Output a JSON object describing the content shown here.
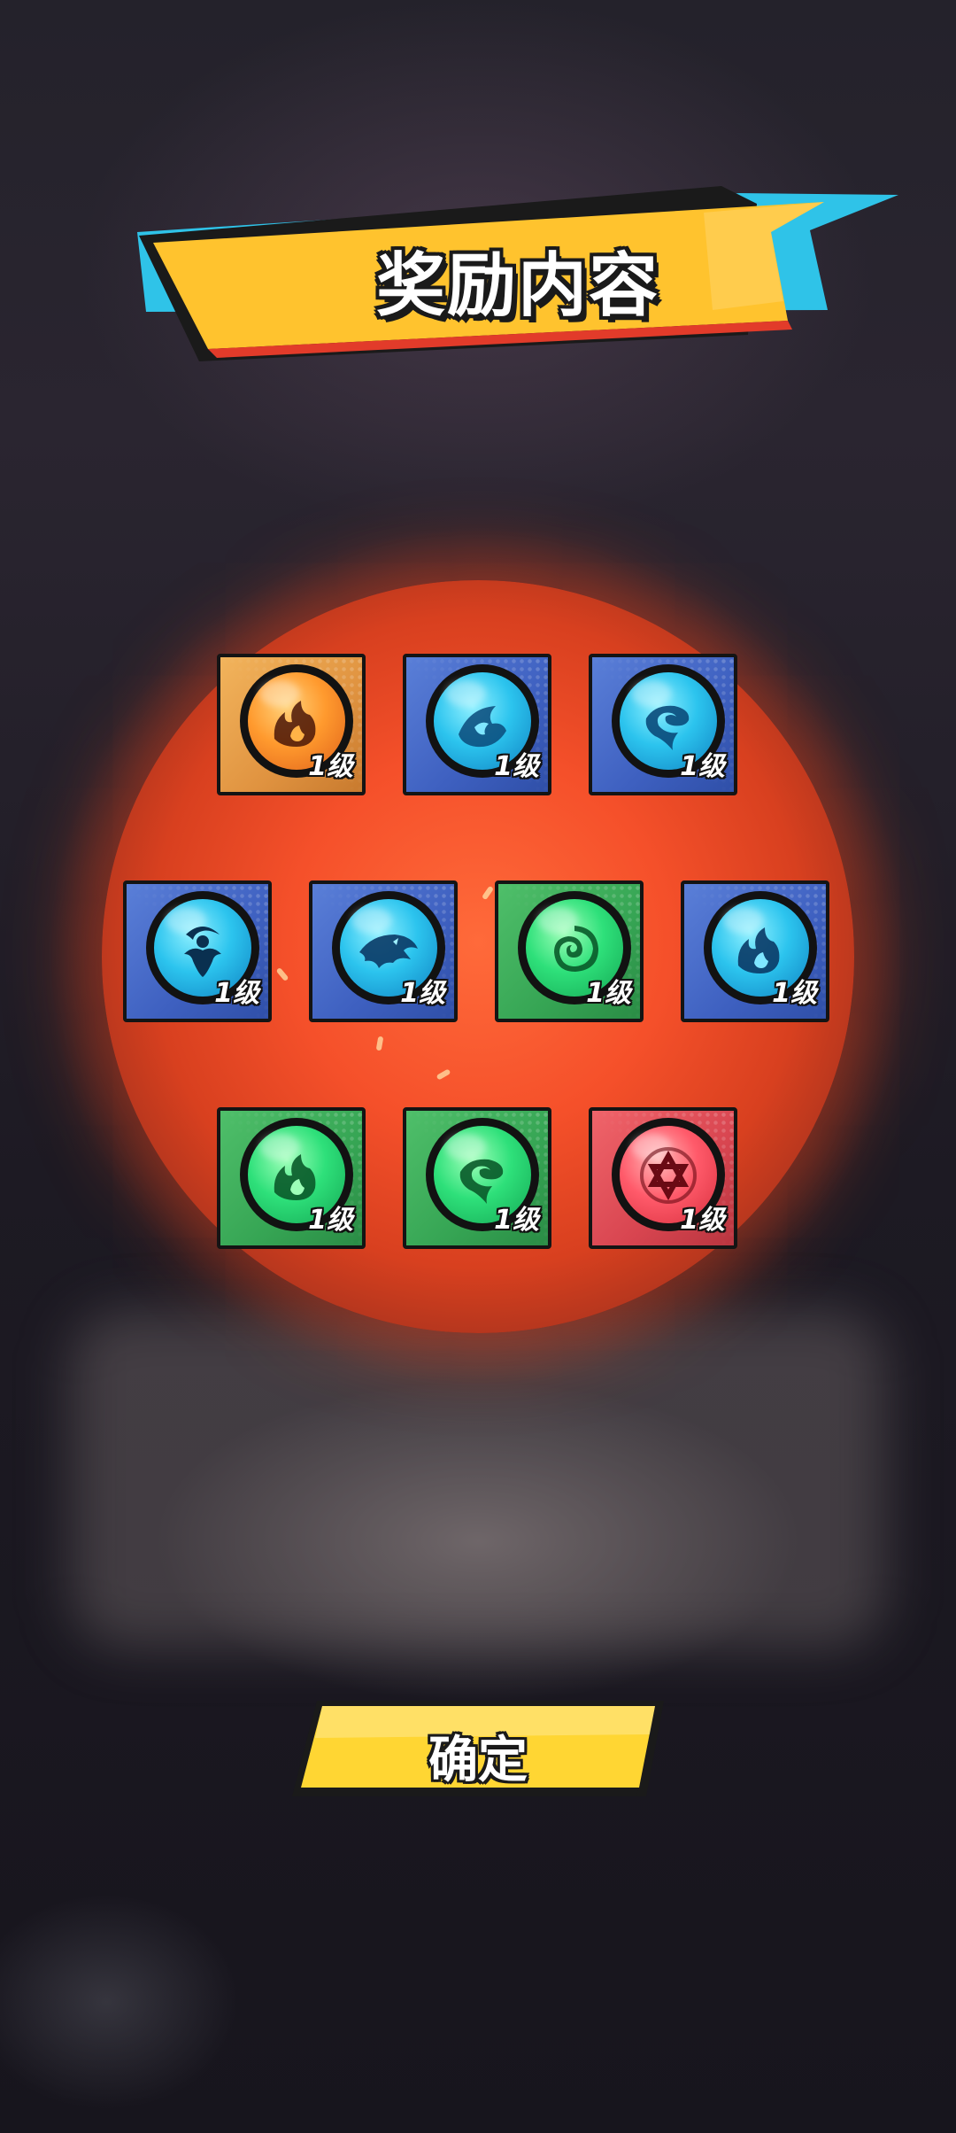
{
  "title": "奖励内容",
  "confirm_button": {
    "label": "确定"
  },
  "colors": {
    "banner_fill": "#ffc32e",
    "banner_accent_cyan": "#2fc3e8",
    "button_fill": "#ffd633",
    "glow": "#f5502a"
  },
  "rewards": [
    {
      "name": "fire-rune",
      "color": "orange",
      "icon": "flame-icon",
      "level": "1级"
    },
    {
      "name": "water-wave-rune",
      "color": "blue",
      "icon": "wave-icon",
      "level": "1级"
    },
    {
      "name": "water-swirl-rune",
      "color": "blue",
      "icon": "swirl-icon",
      "level": "1级"
    },
    {
      "name": "water-moon-rune",
      "color": "blue",
      "icon": "crescent-icon",
      "level": "1级"
    },
    {
      "name": "water-beast-rune",
      "color": "blue",
      "icon": "beast-icon",
      "level": "1级"
    },
    {
      "name": "wind-spiral-rune",
      "color": "green",
      "icon": "spiral-icon",
      "level": "1级"
    },
    {
      "name": "water-flame-rune",
      "color": "blue",
      "icon": "flame-icon",
      "level": "1级"
    },
    {
      "name": "wind-flame-rune",
      "color": "green",
      "icon": "flame-icon",
      "level": "1级"
    },
    {
      "name": "wind-swirl-rune",
      "color": "green",
      "icon": "swirl-icon",
      "level": "1级"
    },
    {
      "name": "fire-star-rune",
      "color": "red",
      "icon": "hexagram-icon",
      "level": "1级"
    }
  ]
}
